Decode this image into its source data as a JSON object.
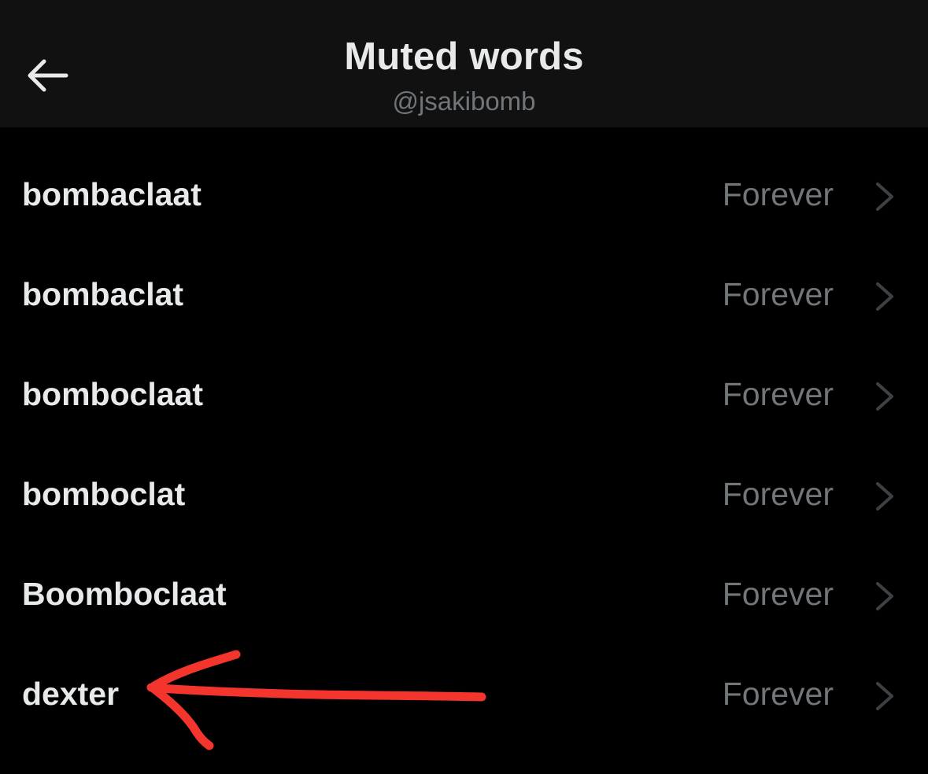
{
  "header": {
    "title": "Muted words",
    "subtitle": "@jsakibomb",
    "back_icon": "arrow-left-icon"
  },
  "muted_words": [
    {
      "word": "bombaclaat",
      "duration": "Forever"
    },
    {
      "word": "bombaclat",
      "duration": "Forever"
    },
    {
      "word": "bomboclaat",
      "duration": "Forever"
    },
    {
      "word": "bomboclat",
      "duration": "Forever"
    },
    {
      "word": "Boomboclaat",
      "duration": "Forever"
    },
    {
      "word": "dexter",
      "duration": "Forever"
    }
  ],
  "row_icon": "chevron-right-icon",
  "colors": {
    "background": "#000000",
    "header_background": "#111111",
    "primary_text": "#e7e9ea",
    "secondary_text": "#71767b",
    "annotation_arrow": "#f4352e"
  }
}
